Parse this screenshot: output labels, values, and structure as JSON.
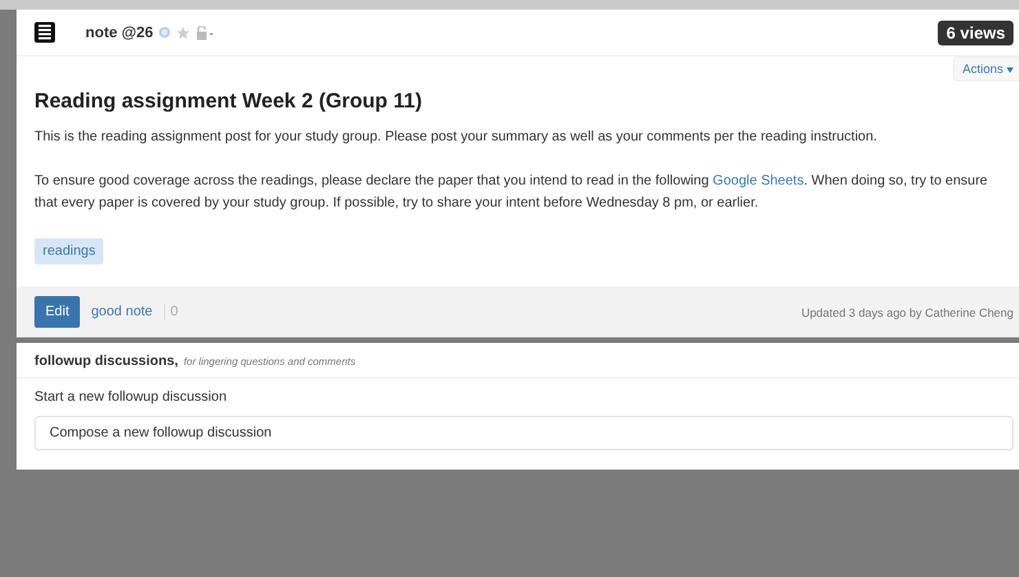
{
  "note": {
    "label": "note @26",
    "starred": false,
    "views": "6 views",
    "actions": "Actions",
    "title": "Reading assignment Week 2 (Group 11)",
    "paragraphs": [
      [
        "This is the reading assignment post for your study group. Please post your summary as well as your comments per the reading instruction."
      ],
      [
        "To ensure good coverage across the readings, please declare the paper that you intend to read in the following ",
        {
          "link": "Google Sheets"
        },
        ". When doing so, try to ensure that every paper is covered by your study group. If possible, try to share your intent before Wednesday 8 pm, or earlier."
      ]
    ],
    "tags": [
      "readings"
    ],
    "edit": "Edit",
    "good_note": "good note",
    "good_note_count": "0",
    "updated": "Updated 3 days ago by Catherine Cheng"
  },
  "followups": {
    "title": "followup discussions,",
    "subtitle": "for lingering questions and comments",
    "start_label": "Start a new followup discussion",
    "compose": {
      "placeholder": "Compose a new followup discussion"
    }
  }
}
